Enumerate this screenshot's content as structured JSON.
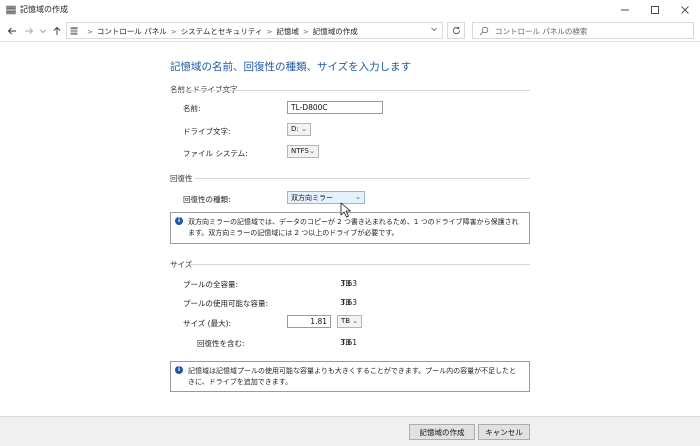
{
  "window": {
    "title": "記憶域の作成",
    "minimize_icon": "minimize-icon",
    "maximize_icon": "maximize-icon",
    "close_icon": "close-icon"
  },
  "nav": {
    "breadcrumb": [
      "コントロール パネル",
      "システムとセキュリティ",
      "記憶域",
      "記憶域の作成"
    ],
    "search_placeholder": "コントロール パネルの検索"
  },
  "page": {
    "heading": "記憶域の名前、回復性の種類、サイズを入力します"
  },
  "name_section": {
    "title": "名前とドライブ文字",
    "name_label": "名前:",
    "name_value": "TL-D800C",
    "drive_label": "ドライブ文字:",
    "drive_value": "D:",
    "fs_label": "ファイル システム:",
    "fs_value": "NTFS"
  },
  "resiliency_section": {
    "title": "回復性",
    "type_label": "回復性の種類:",
    "type_value": "双方向ミラー",
    "info": "双方向ミラーの記憶域では、データのコピーが 2 つ書き込まれるため、1 つのドライブ障害から保護されます。双方向ミラーの記憶域には 2 つ以上のドライブが必要です。"
  },
  "size_section": {
    "title": "サイズ",
    "total_label": "プールの全容量:",
    "total_value": "3.63",
    "total_unit": "TB",
    "available_label": "プールの使用可能な容量:",
    "available_value": "3.63",
    "available_unit": "TB",
    "size_label": "サイズ (最大):",
    "size_value": "1.81",
    "size_unit": "TB",
    "incl_label": "回復性を含む:",
    "incl_value": "3.61",
    "incl_unit": "TB",
    "info": "記憶域は記憶域プールの使用可能な容量よりも大きくすることができます。プール内の容量が不足したときに、ドライブを追加できます。"
  },
  "footer": {
    "create_label": "記憶域の作成",
    "cancel_label": "キャンセル"
  },
  "colors": {
    "accent": "#1e5aa8"
  }
}
